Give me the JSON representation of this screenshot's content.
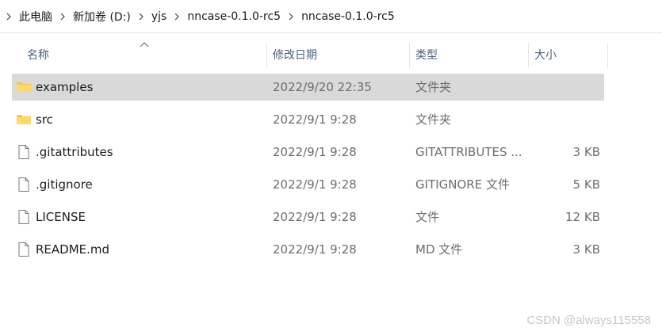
{
  "breadcrumb": {
    "items": [
      "此电脑",
      "新加卷 (D:)",
      "yjs",
      "nncase-0.1.0-rc5",
      "nncase-0.1.0-rc5"
    ]
  },
  "columns": {
    "name": "名称",
    "date": "修改日期",
    "type": "类型",
    "size": "大小"
  },
  "files": [
    {
      "name": "examples",
      "date": "2022/9/20 22:35",
      "type": "文件夹",
      "size": "",
      "icon": "folder-icon",
      "selected": true
    },
    {
      "name": "src",
      "date": "2022/9/1 9:28",
      "type": "文件夹",
      "size": "",
      "icon": "folder-icon",
      "selected": false
    },
    {
      "name": ".gitattributes",
      "date": "2022/9/1 9:28",
      "type": "GITATTRIBUTES ...",
      "size": "3 KB",
      "icon": "file-icon",
      "selected": false
    },
    {
      "name": ".gitignore",
      "date": "2022/9/1 9:28",
      "type": "GITIGNORE 文件",
      "size": "5 KB",
      "icon": "file-icon",
      "selected": false
    },
    {
      "name": "LICENSE",
      "date": "2022/9/1 9:28",
      "type": "文件",
      "size": "12 KB",
      "icon": "file-icon",
      "selected": false
    },
    {
      "name": "README.md",
      "date": "2022/9/1 9:28",
      "type": "MD 文件",
      "size": "3 KB",
      "icon": "file-icon",
      "selected": false
    }
  ],
  "watermark": "CSDN @always115558",
  "colors": {
    "selected_row": "#d9d9d9",
    "folder": "#f5c445",
    "header_text": "#4c607a"
  }
}
